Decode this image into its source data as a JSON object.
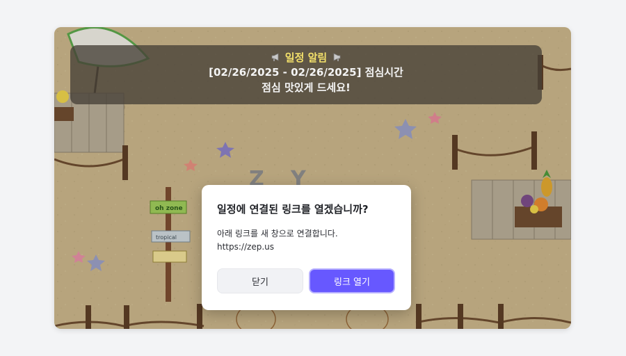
{
  "notice": {
    "title": "일정 알림",
    "line1": "[02/26/2025 - 02/26/2025] 점심시간",
    "line2": "점심 맛있게 드세요!",
    "icon": "megaphone-icon"
  },
  "dialog": {
    "title": "일정에 연결된 링크를 열겠습니까?",
    "message": "아래 링크를 새 창으로 연결합니다.",
    "url": "https://zep.us",
    "close_label": "닫기",
    "open_label": "링크 열기"
  },
  "scene": {
    "signs": [
      "oh zone",
      "tropical"
    ],
    "letters": [
      "Z",
      "Y"
    ]
  },
  "colors": {
    "accent": "#6758ff",
    "sand": "#c9b588",
    "notice_title": "#f3e06a"
  }
}
